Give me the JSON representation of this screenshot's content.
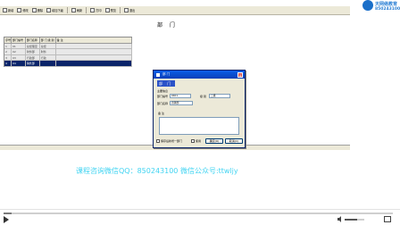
{
  "toolbar": {
    "buttons": [
      {
        "label": "新增"
      },
      {
        "label": "修改"
      },
      {
        "label": "删除"
      },
      {
        "label": "增加下级"
      },
      {
        "label": "刷新"
      },
      {
        "label": "打印"
      },
      {
        "label": "预览"
      },
      {
        "label": "退出"
      }
    ]
  },
  "page": {
    "title": "部 门"
  },
  "grid": {
    "columns": [
      "序号",
      "部门编号",
      "部门名称",
      "部 门 级 别",
      "备 注"
    ],
    "rows": [
      [
        "1",
        "01",
        "总经理室",
        "总经",
        ""
      ],
      [
        "2",
        "02",
        "财务部",
        "财务",
        ""
      ],
      [
        "3",
        "03",
        "行政部",
        "行政",
        ""
      ],
      [
        "4",
        "04",
        "销售部",
        "",
        ""
      ]
    ],
    "selected_index": 3
  },
  "dialog": {
    "title": "部 门",
    "big_title": "部 门",
    "section_label": "主要信息",
    "dept_code_label": "部门编号",
    "dept_code_value": "0401",
    "level_label": "级 别",
    "level_value": "二级",
    "dept_name_label": "部门名称",
    "dept_name_value": "直销部",
    "notes_label": "备 注",
    "checkbox1_label": "保存后新增一部门",
    "checkbox2_label": "使用",
    "ok_label": "确定(O)",
    "cancel_label": "取消(C)",
    "close_glyph": "x"
  },
  "brand": {
    "name": "天网络教育",
    "phone": "850243100"
  },
  "promo": {
    "text": "课程咨询微信QQ：850243100    微信公众号:ttwljy"
  },
  "player": {
    "progress_percent": 2,
    "volume_percent": 65
  },
  "colors": {
    "accent": "#0a246a",
    "promo": "#42d4f2",
    "brand": "#2a7fd4"
  }
}
